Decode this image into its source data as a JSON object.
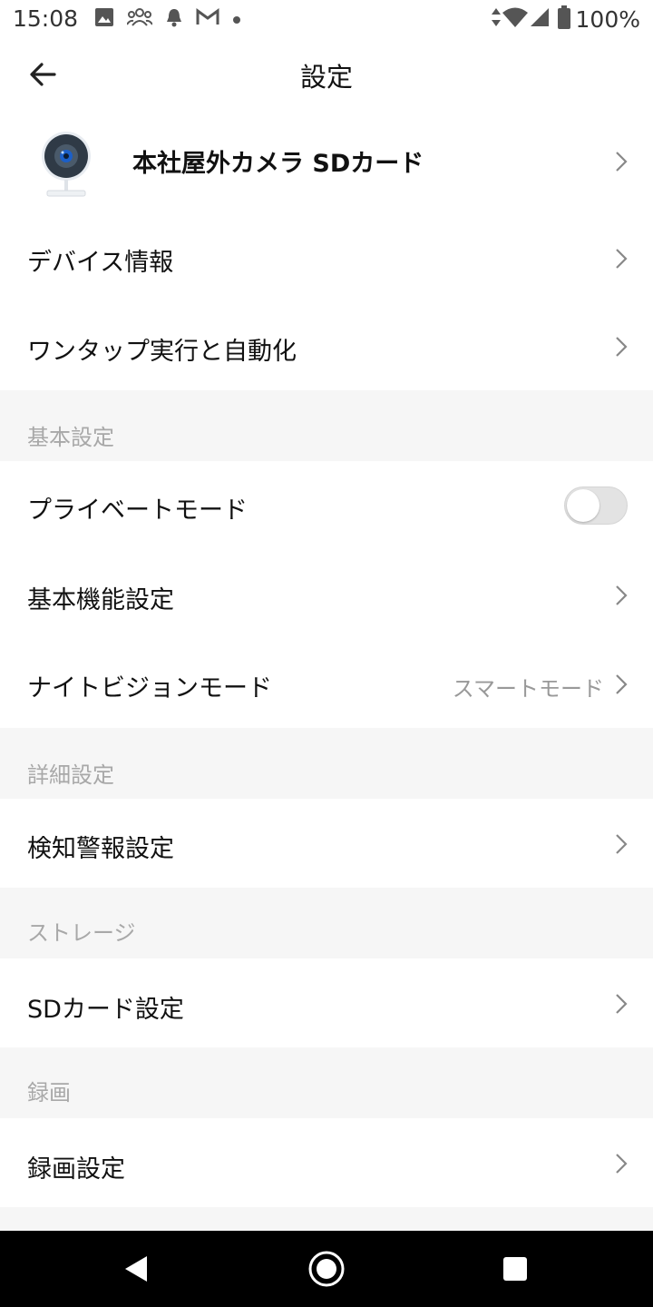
{
  "status_bar": {
    "time": "15:08",
    "battery_percent": "100%",
    "notification_icons": [
      "image-icon",
      "group-icon",
      "bell-icon",
      "gmail-icon",
      "dot-icon"
    ],
    "system_icons": [
      "data-arrows-icon",
      "wifi-icon",
      "signal-icon",
      "battery-icon"
    ]
  },
  "header": {
    "title": "設定"
  },
  "device": {
    "name": "本社屋外カメラ SDカード"
  },
  "top_items": [
    {
      "label": "デバイス情報"
    },
    {
      "label": "ワンタップ実行と自動化"
    }
  ],
  "sections": {
    "basic": {
      "label": "基本設定",
      "items": [
        {
          "label": "プライベートモード",
          "toggle_on": false
        },
        {
          "label": "基本機能設定"
        },
        {
          "label": "ナイトビジョンモード",
          "value": "スマートモード"
        }
      ]
    },
    "advanced": {
      "label": "詳細設定",
      "items": [
        {
          "label": "検知警報設定"
        }
      ]
    },
    "storage": {
      "label": "ストレージ",
      "items": [
        {
          "label": "SDカード設定"
        }
      ]
    },
    "recording": {
      "label": "録画",
      "items": [
        {
          "label": "録画設定"
        }
      ]
    }
  },
  "colors": {
    "section_background": "#f6f6f6",
    "section_text": "#a8a8a8",
    "value_text": "#999999",
    "toggle_off": "#e3e3e3",
    "navbar": "#000000"
  },
  "nav_bar": {
    "buttons": [
      "back-triangle-icon",
      "home-circle-icon",
      "recents-square-icon"
    ]
  }
}
